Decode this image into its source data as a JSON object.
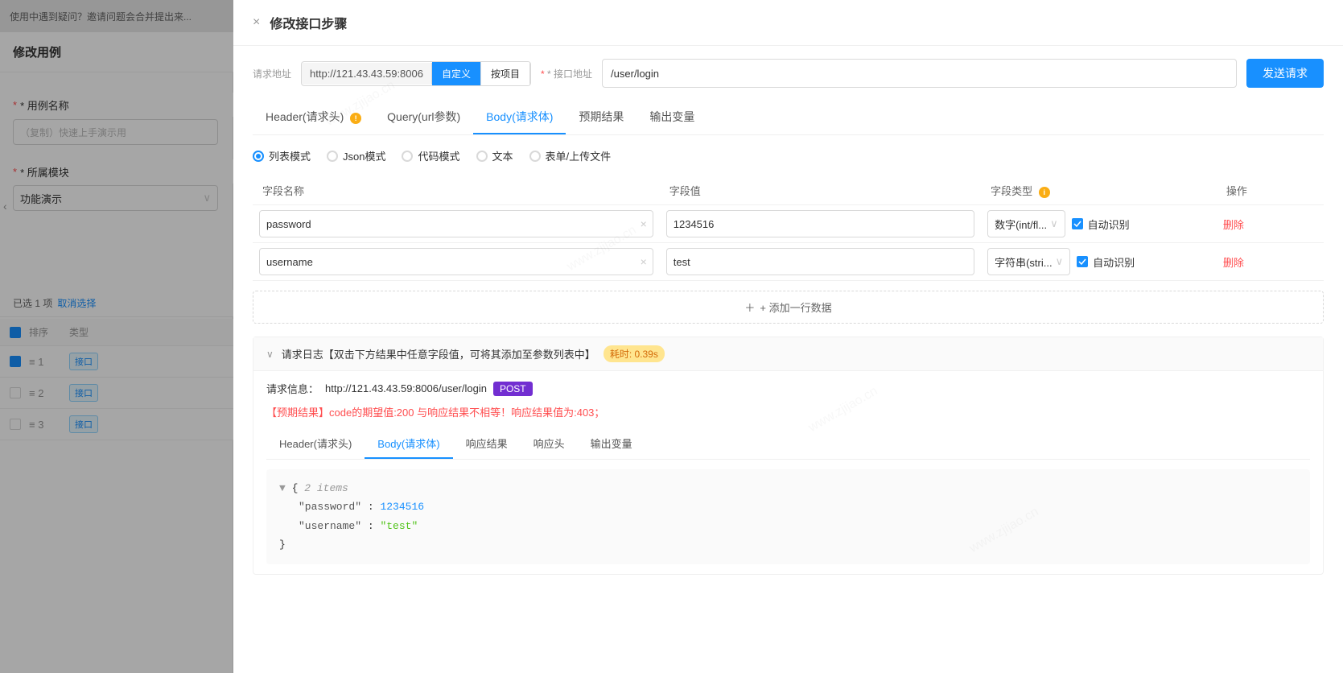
{
  "background": {
    "header_text": "使用中遇到疑问？邀请问题会合并提出来...",
    "sidebar_title": "修改用例",
    "label_name": "* 用例名称",
    "input_name_value": "（复制）快速上手演示用",
    "label_module": "* 所属模块",
    "input_module_value": "功能演示",
    "selected_info": "已选 1 项",
    "cancel_select": "取消选择",
    "table_headers": [
      "排序",
      "类型"
    ],
    "table_rows": [
      {
        "order": "≡ 1",
        "type": "接口",
        "checked": true
      },
      {
        "order": "≡ 2",
        "type": "接口",
        "checked": false
      },
      {
        "order": "≡ 3",
        "type": "接口",
        "checked": false
      }
    ]
  },
  "modal": {
    "close_icon": "×",
    "title": "修改接口步骤",
    "url_section": {
      "request_label": "请求地址",
      "api_label": "* 接口地址",
      "url_prefix": "http://121.43.43.59:8006",
      "btn_custom": "自定义",
      "btn_project": "按项目",
      "api_path": "/user/login",
      "send_btn": "发送请求"
    },
    "tabs": [
      {
        "key": "header",
        "label": "Header(请求头)",
        "active": false,
        "hint": "!"
      },
      {
        "key": "query",
        "label": "Query(url参数)",
        "active": false
      },
      {
        "key": "body",
        "label": "Body(请求体)",
        "active": true
      },
      {
        "key": "expected",
        "label": "预期结果",
        "active": false
      },
      {
        "key": "output",
        "label": "输出变量",
        "active": false
      }
    ],
    "body_tab": {
      "modes": [
        {
          "key": "list",
          "label": "列表模式",
          "checked": true
        },
        {
          "key": "json",
          "label": "Json模式",
          "checked": false
        },
        {
          "key": "code",
          "label": "代码模式",
          "checked": false
        },
        {
          "key": "text",
          "label": "文本",
          "checked": false
        },
        {
          "key": "form",
          "label": "表单/上传文件",
          "checked": false
        }
      ],
      "table": {
        "col_field": "字段名称",
        "col_value": "字段值",
        "col_type": "字段类型",
        "col_type_hint": "i",
        "col_action": "操作",
        "rows": [
          {
            "field": "password",
            "value": "1234516",
            "type": "数字(int/fl...",
            "auto_detect": true,
            "auto_label": "自动识别",
            "delete_label": "删除"
          },
          {
            "field": "username",
            "value": "test",
            "type": "字符串(stri...",
            "auto_detect": true,
            "auto_label": "自动识别",
            "delete_label": "删除"
          }
        ]
      },
      "add_row_label": "+ 添加一行数据"
    },
    "log_section": {
      "chevron": "∨",
      "title": "请求日志【双击下方结果中任意字段值，可将其添加至参数列表中】",
      "time_badge": "耗时: 0.39s",
      "request_info_prefix": "请求信息：",
      "request_url": "http://121.43.43.59:8006/user/login",
      "method_badge": "POST",
      "error_msg": "【预期结果】code的期望值:200 与响应结果不相等！响应结果值为:403；",
      "result_tabs": [
        {
          "key": "req-header",
          "label": "Header(请求头)",
          "active": false
        },
        {
          "key": "req-body",
          "label": "Body(请求体)",
          "active": true
        },
        {
          "key": "resp-result",
          "label": "响应结果",
          "active": false
        },
        {
          "key": "resp-header",
          "label": "响应头",
          "active": false
        },
        {
          "key": "output-var",
          "label": "输出变量",
          "active": false
        }
      ],
      "json_display": {
        "brace_open": "{",
        "comment": "2 items",
        "fields": [
          {
            "key": "\"password\"",
            "separator": ": ",
            "value": "1234516",
            "type": "number"
          },
          {
            "key": "\"username\"",
            "separator": ": ",
            "value": "\"test\"",
            "type": "string"
          }
        ],
        "brace_close": "}"
      }
    }
  },
  "watermarks": [
    "www.zjijao.cn",
    "www.zjijao.cn",
    "www.zjijao.cn"
  ]
}
